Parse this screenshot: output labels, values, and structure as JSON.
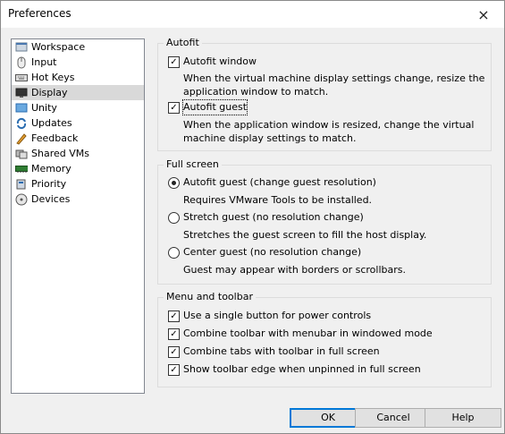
{
  "window": {
    "title": "Preferences",
    "close_icon": "×"
  },
  "sidebar": {
    "items": [
      {
        "label": "Workspace",
        "icon": "workspace-icon",
        "selected": false
      },
      {
        "label": "Input",
        "icon": "mouse-icon",
        "selected": false
      },
      {
        "label": "Hot Keys",
        "icon": "keyboard-icon",
        "selected": false
      },
      {
        "label": "Display",
        "icon": "monitor-icon",
        "selected": true
      },
      {
        "label": "Unity",
        "icon": "unity-icon",
        "selected": false
      },
      {
        "label": "Updates",
        "icon": "updates-icon",
        "selected": false
      },
      {
        "label": "Feedback",
        "icon": "feedback-icon",
        "selected": false
      },
      {
        "label": "Shared VMs",
        "icon": "shared-vms-icon",
        "selected": false
      },
      {
        "label": "Memory",
        "icon": "memory-icon",
        "selected": false
      },
      {
        "label": "Priority",
        "icon": "priority-icon",
        "selected": false
      },
      {
        "label": "Devices",
        "icon": "devices-icon",
        "selected": false
      }
    ]
  },
  "autofit": {
    "legend": "Autofit",
    "window_label": "Autofit window",
    "window_checked": true,
    "window_desc": "When the virtual machine display settings change, resize the application window to match.",
    "guest_label": "Autofit guest",
    "guest_checked": true,
    "guest_desc": "When the application window is resized, change the virtual machine display settings to match."
  },
  "fullscreen": {
    "legend": "Full screen",
    "options": [
      {
        "label": "Autofit guest (change guest resolution)",
        "desc": "Requires VMware Tools to be installed.",
        "selected": true
      },
      {
        "label": "Stretch guest (no resolution change)",
        "desc": "Stretches the guest screen to fill the host display.",
        "selected": false
      },
      {
        "label": "Center guest (no resolution change)",
        "desc": "Guest may appear with borders or scrollbars.",
        "selected": false
      }
    ]
  },
  "toolbar": {
    "legend": "Menu and toolbar",
    "options": [
      {
        "label": "Use a single button for power controls",
        "checked": true
      },
      {
        "label": "Combine toolbar with menubar in windowed mode",
        "checked": true
      },
      {
        "label": "Combine tabs with toolbar in full screen",
        "checked": true
      },
      {
        "label": "Show toolbar edge when unpinned in full screen",
        "checked": true
      }
    ]
  },
  "buttons": {
    "ok": "OK",
    "cancel": "Cancel",
    "help": "Help"
  },
  "colors": {
    "accent": "#0078d7",
    "selected_bg": "#d9d9d9"
  }
}
